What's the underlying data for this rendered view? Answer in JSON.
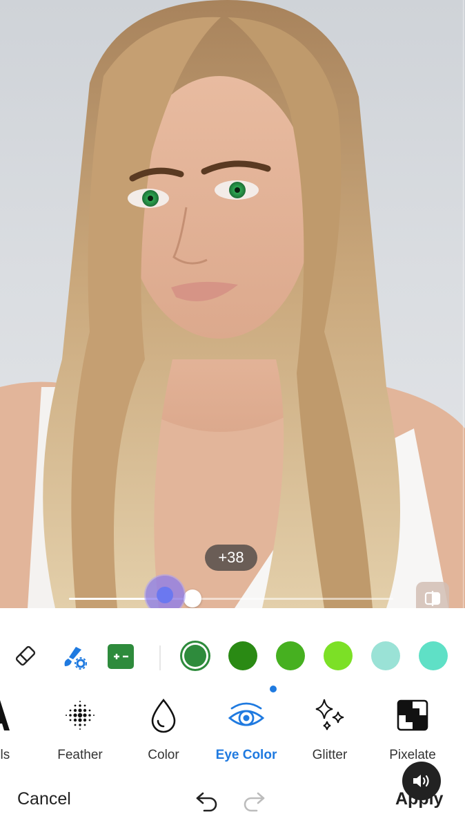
{
  "slider": {
    "value_label": "+38",
    "value": 38
  },
  "colors": {
    "accent": "#1f7ae0",
    "swatches": [
      "#2e8b3c",
      "#2a8a14",
      "#46b020",
      "#7ce026",
      "#9ae2d6",
      "#5fe0c6"
    ],
    "selected_swatch": "#2e8b3c"
  },
  "tools": [
    "eraser-icon",
    "brush-settings-icon",
    "invert-mask-icon"
  ],
  "effects": [
    {
      "label": "ails",
      "icon": "details-icon"
    },
    {
      "label": "Feather",
      "icon": "feather-dots-icon"
    },
    {
      "label": "Color",
      "icon": "color-drop-icon"
    },
    {
      "label": "Eye Color",
      "icon": "eye-icon",
      "active": true
    },
    {
      "label": "Glitter",
      "icon": "sparkles-icon"
    },
    {
      "label": "Pixelate",
      "icon": "pixelate-icon"
    }
  ],
  "footer": {
    "cancel_label": "Cancel",
    "apply_label": "Apply"
  }
}
